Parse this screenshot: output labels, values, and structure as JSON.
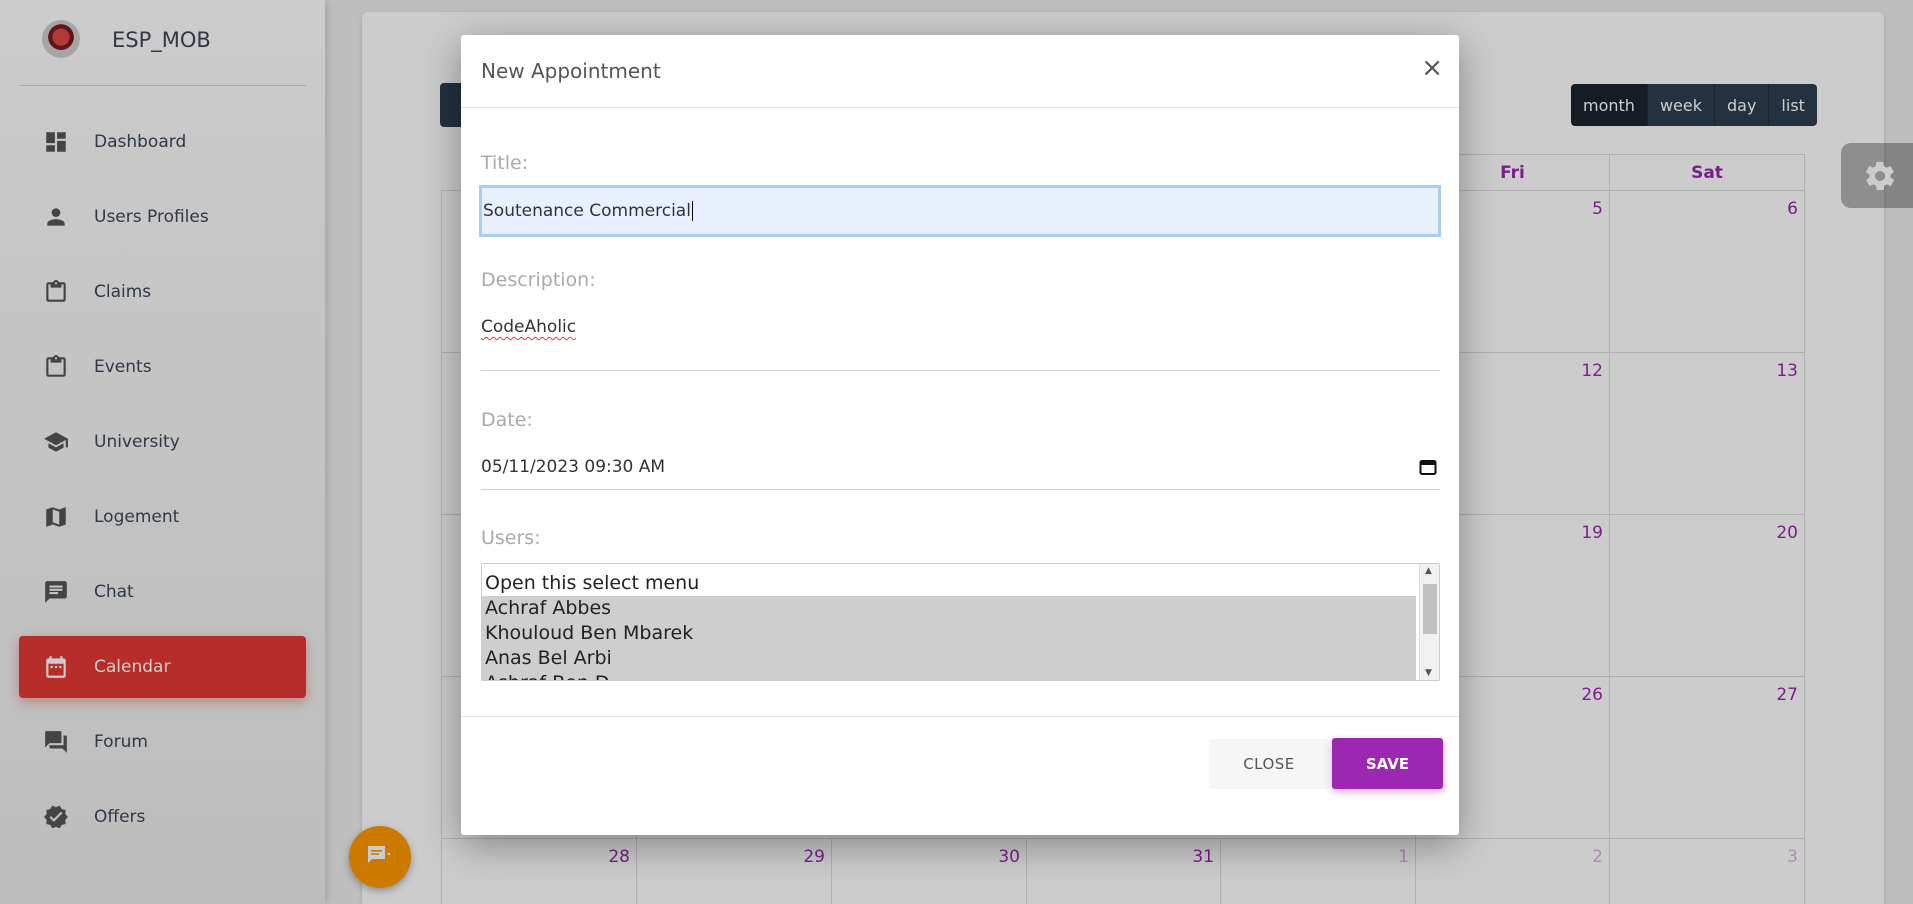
{
  "sidebar": {
    "brand": "ESP_MOB",
    "items": [
      {
        "label": "Dashboard",
        "icon": "dashboard-icon"
      },
      {
        "label": "Users Profiles",
        "icon": "person-icon"
      },
      {
        "label": "Claims",
        "icon": "clipboard-icon"
      },
      {
        "label": "Events",
        "icon": "clipboard-icon"
      },
      {
        "label": "University",
        "icon": "school-icon"
      },
      {
        "label": "Logement",
        "icon": "map-icon"
      },
      {
        "label": "Chat",
        "icon": "chat-icon"
      },
      {
        "label": "Calendar",
        "icon": "calendar-icon",
        "active": true
      },
      {
        "label": "Forum",
        "icon": "forum-icon"
      },
      {
        "label": "Offers",
        "icon": "verified-icon"
      }
    ]
  },
  "calendar": {
    "views": [
      "month",
      "week",
      "day",
      "list"
    ],
    "active_view": "month",
    "headers": [
      "Fri",
      "Sat"
    ],
    "numbers": {
      "fri": [
        "5",
        "12",
        "19",
        "26"
      ],
      "sat": [
        "6",
        "13",
        "20",
        "27"
      ],
      "last_row": [
        "28",
        "29",
        "30",
        "31",
        "1",
        "2",
        "3"
      ]
    }
  },
  "modal": {
    "title": "New Appointment",
    "close_symbol": "×",
    "title_label": "Title:",
    "title_value": "Soutenance Commercial",
    "description_label": "Description:",
    "description_value": "CodeAholic",
    "date_label": "Date:",
    "date_value": "05/11/2023 09:30 AM",
    "users_label": "Users:",
    "users_options": [
      "Open this select menu",
      "Achraf Abbes",
      "Khouloud Ben Mbarek",
      "Anas Bel Arbi",
      "Ashraf Ben D..."
    ],
    "close_button": "CLOSE",
    "save_button": "SAVE"
  },
  "colors": {
    "accent": "#9c27b0",
    "active_nav": "#e53935",
    "fab": "#ff9800"
  }
}
